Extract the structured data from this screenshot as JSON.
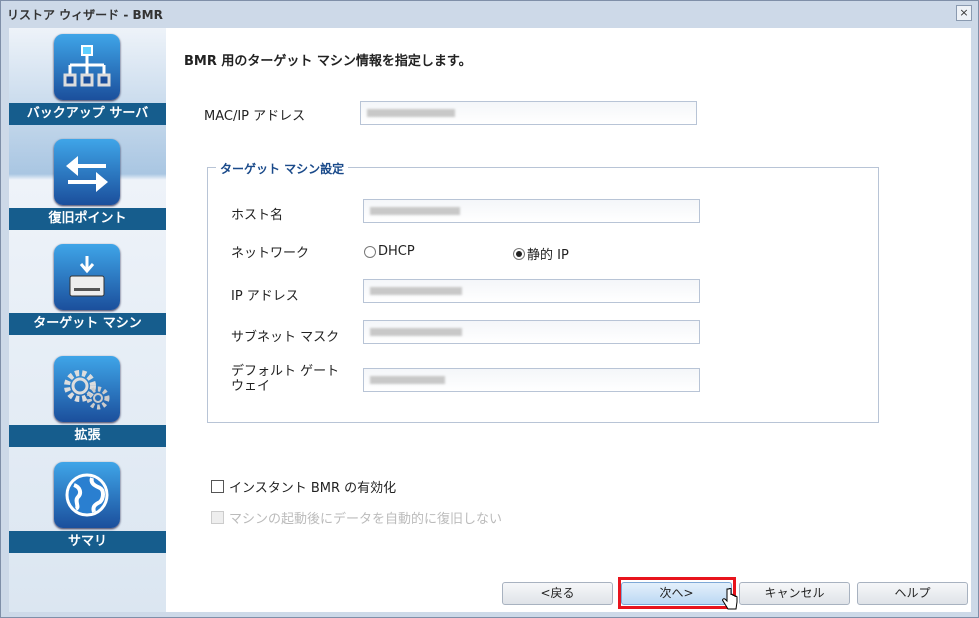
{
  "window": {
    "title": "リストア ウィザード - BMR",
    "close_icon": "×"
  },
  "sidebar": {
    "items": [
      {
        "label": "バックアップ サーバ",
        "icon": "network-tree-icon"
      },
      {
        "label": "復旧ポイント",
        "icon": "arrows-icon"
      },
      {
        "label": "ターゲット マシン",
        "icon": "disk-download-icon"
      },
      {
        "label": "拡張",
        "icon": "gears-icon"
      },
      {
        "label": "サマリ",
        "icon": "globe-icon"
      }
    ]
  },
  "main": {
    "heading": "BMR 用のターゲット マシン情報を指定します。",
    "mac_ip_label": "MAC/IP アドレス",
    "fieldset_legend": "ターゲット マシン設定",
    "host_label": "ホスト名",
    "network_label": "ネットワーク",
    "dhcp_label": "DHCP",
    "static_ip_label": "静的 IP",
    "network_selected": "静的 IP",
    "ip_label": "IP アドレス",
    "subnet_label": "サブネット マスク",
    "gateway_label": "デフォルト ゲート ウェイ",
    "instant_bmr_label": "インスタント BMR の有効化",
    "instant_bmr_checked": false,
    "no_auto_recover_label": "マシンの起動後にデータを自動的に復旧しない",
    "no_auto_recover_enabled": false
  },
  "buttons": {
    "back": "<戻る",
    "next": "次へ>",
    "cancel": "キャンセル",
    "help": "ヘルプ"
  }
}
